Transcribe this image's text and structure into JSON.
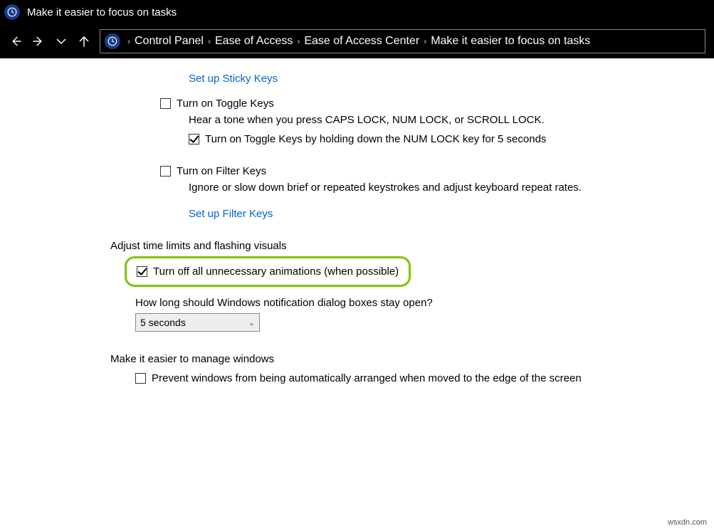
{
  "window": {
    "title": "Make it easier to focus on tasks"
  },
  "breadcrumb": {
    "items": [
      "Control Panel",
      "Ease of Access",
      "Ease of Access Center",
      "Make it easier to focus on tasks"
    ]
  },
  "links": {
    "sticky": "Set up Sticky Keys",
    "filter": "Set up Filter Keys"
  },
  "toggleKeys": {
    "label": "Turn on Toggle Keys",
    "desc": "Hear a tone when you press CAPS LOCK, NUM LOCK, or SCROLL LOCK.",
    "subLabel": "Turn on Toggle Keys by holding down the NUM LOCK key for 5 seconds"
  },
  "filterKeys": {
    "label": "Turn on Filter Keys",
    "desc": "Ignore or slow down brief or repeated keystrokes and adjust keyboard repeat rates."
  },
  "section1": {
    "header": "Adjust time limits and flashing visuals"
  },
  "anim": {
    "label": "Turn off all unnecessary animations (when possible)"
  },
  "notif": {
    "question": "How long should Windows notification dialog boxes stay open?",
    "value": "5 seconds"
  },
  "section2": {
    "header": "Make it easier to manage windows"
  },
  "arrange": {
    "label": "Prevent windows from being automatically arranged when moved to the edge of the screen"
  },
  "watermark": "wsxdn.com"
}
